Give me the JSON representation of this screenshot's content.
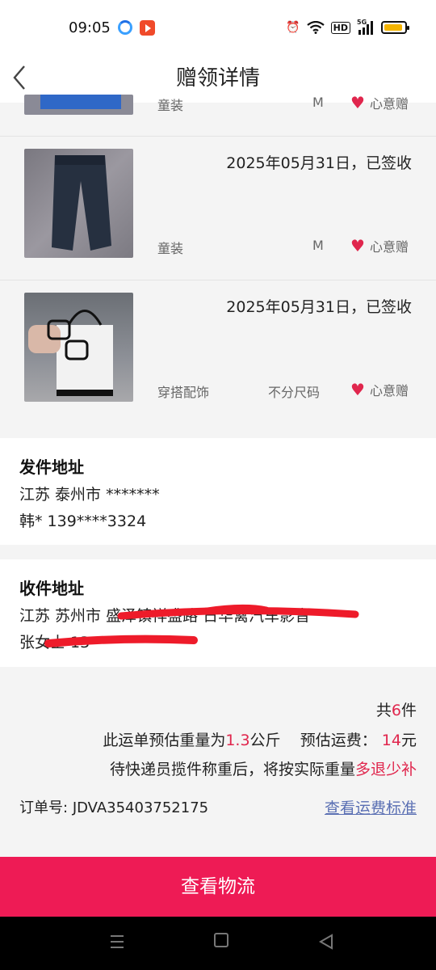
{
  "status_bar": {
    "time": "09:05",
    "signal_label": "5G",
    "hd_label": "HD"
  },
  "header": {
    "title": "赠领详情"
  },
  "items": [
    {
      "date": "",
      "category": "童装",
      "size": "M",
      "gift_type": "心意赠"
    },
    {
      "date": "2025年05月31日，已签收",
      "category": "童装",
      "size": "M",
      "gift_type": "心意赠"
    },
    {
      "date": "2025年05月31日，已签收",
      "category": "穿搭配饰",
      "size": "不分尺码",
      "gift_type": "心意赠"
    }
  ],
  "sender": {
    "title": "发件地址",
    "address": "江苏 泰州市 *******",
    "contact": "韩* 139****3324"
  },
  "receiver": {
    "title": "收件地址",
    "address": "江苏 苏州市 盛泽镇祥盛路 日华禽汽车影音",
    "contact": "张女士 13"
  },
  "summary": {
    "count_prefix": "共",
    "count": "6",
    "count_suffix": "件",
    "weight_prefix": "此运单预估重量为",
    "weight": "1.3",
    "weight_unit": "公斤",
    "fee_label": "预估运费：",
    "fee": "14",
    "fee_unit": "元",
    "note_prefix": "待快递员揽件称重后，将按实际重量",
    "note_highlight": "多退少补",
    "order_label": "订单号:",
    "order_no": "JDVA35403752175",
    "fee_standard_link": "查看运费标准"
  },
  "actions": {
    "logistics": "查看物流"
  },
  "colors": {
    "accent": "#ee1b55",
    "highlight": "#e0264d",
    "link": "#5a6fb3"
  }
}
